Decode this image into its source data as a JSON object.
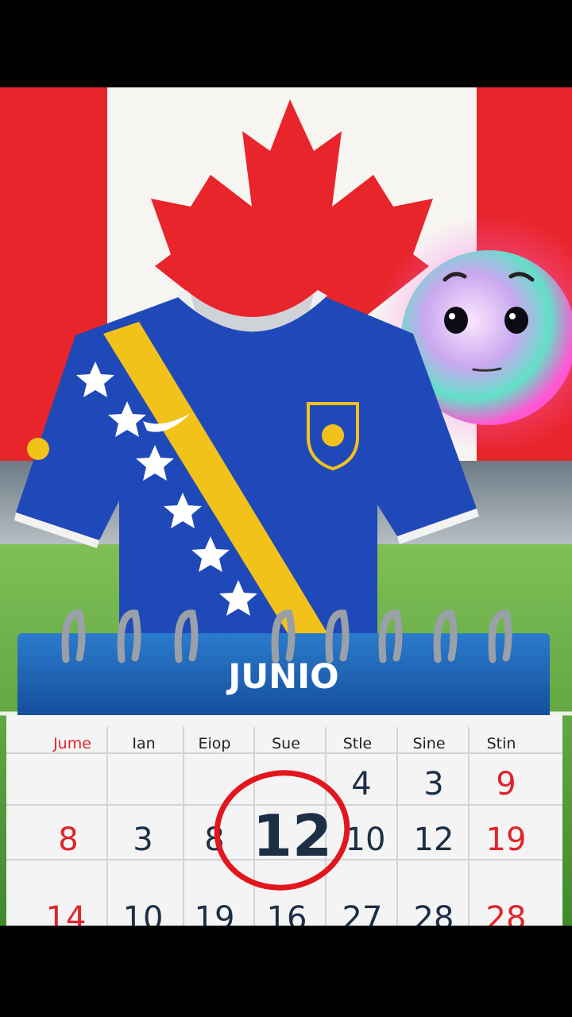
{
  "calendar": {
    "month": "JUNIO",
    "weekday_headers": [
      "Jume",
      "Ian",
      "Eiop",
      "Sue",
      "Stle",
      "Sine",
      "Stin"
    ],
    "rows": [
      [
        "",
        "",
        "",
        "",
        "4",
        "3",
        "9"
      ],
      [
        "8",
        "3",
        "8",
        "12",
        "10",
        "12",
        "19"
      ],
      [
        "14",
        "10",
        "19",
        "16",
        "27",
        "28",
        "28"
      ]
    ],
    "highlighted_day": "12",
    "highlight_color": "#e3161d"
  },
  "colors": {
    "flag_red": "#e8252b",
    "jersey_blue": "#1f49b8",
    "sash_yellow": "#f2c21b",
    "pitch_green": "#4f9a35",
    "calendar_header_blue": "#1a63b4"
  }
}
